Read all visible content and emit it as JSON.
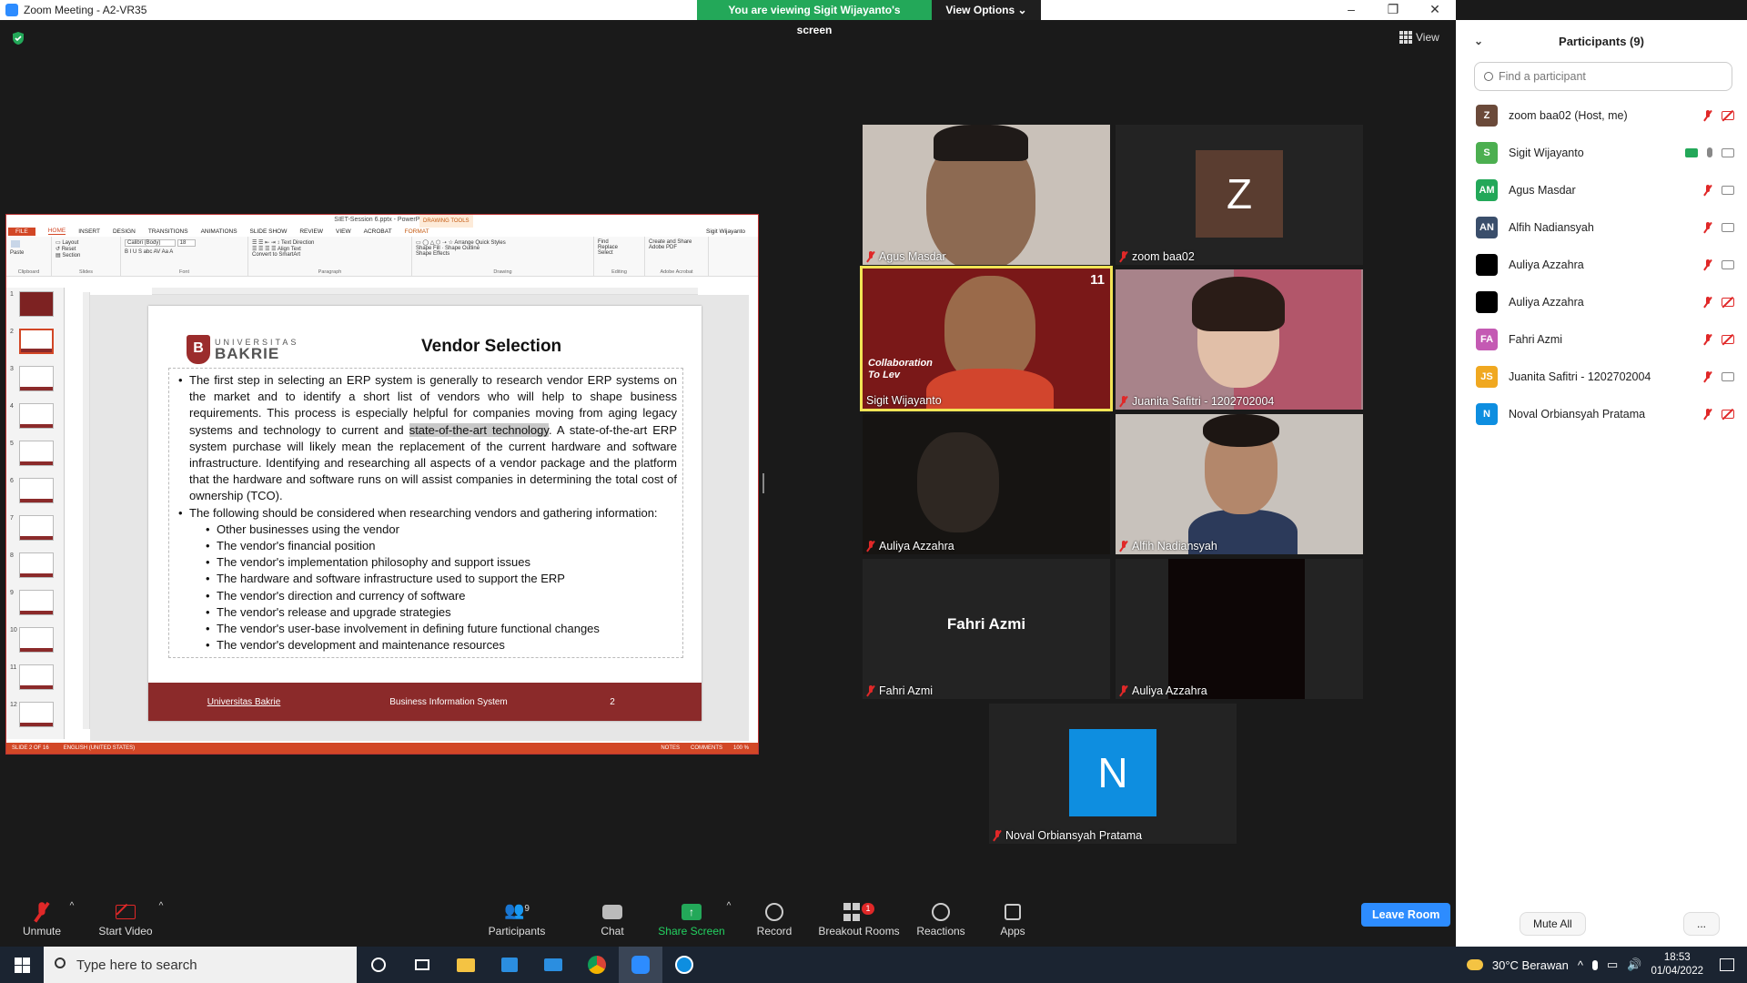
{
  "window": {
    "title": "Zoom Meeting - A2-VR35"
  },
  "banner": {
    "viewing": "You are viewing Sigit Wijayanto's screen",
    "view_options": "View Options"
  },
  "view_button": "View",
  "ppt": {
    "window_title": "SIET-Session 6.pptx - PowerPoint",
    "drawing_tools": "DRAWING TOOLS",
    "user": "Sigit Wijayanto",
    "tabs": [
      "FILE",
      "HOME",
      "INSERT",
      "DESIGN",
      "TRANSITIONS",
      "ANIMATIONS",
      "SLIDE SHOW",
      "REVIEW",
      "VIEW",
      "ACROBAT",
      "FORMAT"
    ],
    "ribbon": {
      "paste": "Paste",
      "new_slide": "New Slide",
      "layout": "Layout",
      "reset": "Reset",
      "section": "Section",
      "font": "Calibri (Body)",
      "size": "18",
      "text_direction": "Text Direction",
      "align_text": "Align Text",
      "convert_smartart": "Convert to SmartArt",
      "arrange": "Arrange",
      "quick_styles": "Quick Styles",
      "shape_fill": "Shape Fill",
      "shape_outline": "Shape Outline",
      "shape_effects": "Shape Effects",
      "find": "Find",
      "replace": "Replace",
      "select": "Select",
      "create_share_pdf": "Create and Share Adobe PDF",
      "groups": [
        "Clipboard",
        "Slides",
        "Font",
        "Paragraph",
        "Drawing",
        "Editing",
        "Adobe Acrobat"
      ]
    },
    "thumb_numbers": [
      "1",
      "2",
      "3",
      "4",
      "5",
      "6",
      "7",
      "8",
      "9",
      "10",
      "11",
      "12"
    ],
    "slide": {
      "logo_top": "UNIVERSITAS",
      "logo_bottom": "BAKRIE",
      "title": "Vendor Selection",
      "para1_a": "The first step in selecting an ERP system is generally to research vendor ERP systems on the market and to identify a short list of vendors who will help to shape business requirements. This process is especially helpful for companies moving from aging legacy systems and technology to current and ",
      "para1_hl": "state-of-the-art technology",
      "para1_b": ". A state-of-the-art ERP system purchase will likely mean the replacement of the current hardware and software infrastructure. Identifying and researching all aspects of a vendor package and the platform that the hardware and software runs on will assist companies in determining the total cost of ownership (TCO).",
      "para2": "The following should be considered when researching vendors and gathering information:",
      "sub_items": [
        "Other businesses using the vendor",
        "The vendor's financial position",
        "The vendor's implementation philosophy and support issues",
        "The hardware and software infrastructure used to support the ERP",
        "The vendor's direction and currency of software",
        "The vendor's release and upgrade strategies",
        "The vendor's user-base involvement in defining future functional changes",
        "The vendor's development and maintenance resources"
      ],
      "footer_left": "Universitas Bakrie",
      "footer_center": "Business Information System",
      "footer_right": "2"
    },
    "status": {
      "slide": "SLIDE 2 OF 16",
      "lang": "ENGLISH (UNITED STATES)",
      "notes": "NOTES",
      "comments": "COMMENTS",
      "zoom": "100 %"
    }
  },
  "tiles": [
    {
      "name": "Agus Masdar"
    },
    {
      "name": "zoom baa02",
      "avatar": "Z"
    },
    {
      "name": "Sigit Wijayanto",
      "overlay_text": "Collaboration To Lev",
      "badge": "11"
    },
    {
      "name": "Juanita Safitri - 1202702004"
    },
    {
      "name": "Auliya Azzahra"
    },
    {
      "name": "Alfih Nadiansyah"
    },
    {
      "name": "Fahri Azmi",
      "center_name": "Fahri Azmi"
    },
    {
      "name": "Auliya Azzahra"
    },
    {
      "name": "Noval Orbiansyah Pratama",
      "avatar": "N"
    }
  ],
  "participants_panel": {
    "title": "Participants (9)",
    "search_placeholder": "Find a participant",
    "rows": [
      {
        "initials": "Z",
        "name": "zoom baa02 (Host, me)",
        "color": "#6b4a3a"
      },
      {
        "initials": "S",
        "name": "Sigit Wijayanto",
        "color": "#4caf50"
      },
      {
        "initials": "AM",
        "name": "Agus Masdar",
        "color": "#23a859"
      },
      {
        "initials": "AN",
        "name": "Alfih Nadiansyah",
        "color": "#3a4e6b"
      },
      {
        "initials": "",
        "name": "Auliya Azzahra",
        "color": "#000000"
      },
      {
        "initials": "",
        "name": "Auliya Azzahra",
        "color": "#000000"
      },
      {
        "initials": "FA",
        "name": "Fahri Azmi",
        "color": "#c45ab3"
      },
      {
        "initials": "JS",
        "name": "Juanita Safitri - 1202702004",
        "color": "#f0a820"
      },
      {
        "initials": "N",
        "name": "Noval Orbiansyah Pratama",
        "color": "#0e8ee0"
      }
    ],
    "mute_all": "Mute All",
    "more": "..."
  },
  "toolbar": {
    "unmute": "Unmute",
    "start_video": "Start Video",
    "participants": "Participants",
    "participants_count": "9",
    "chat": "Chat",
    "share_screen": "Share Screen",
    "record": "Record",
    "breakout_rooms": "Breakout Rooms",
    "breakout_badge": "1",
    "reactions": "Reactions",
    "apps": "Apps",
    "leave_room": "Leave Room"
  },
  "taskbar": {
    "search_placeholder": "Type here to search",
    "weather": "30°C  Berawan",
    "time": "18:53",
    "date": "01/04/2022"
  },
  "colors": {
    "accent": "#2d8cff",
    "share_green": "#23a859",
    "mute_red": "#e02828",
    "slide_red": "#8b2a2a",
    "ppt_orange": "#d24726"
  }
}
